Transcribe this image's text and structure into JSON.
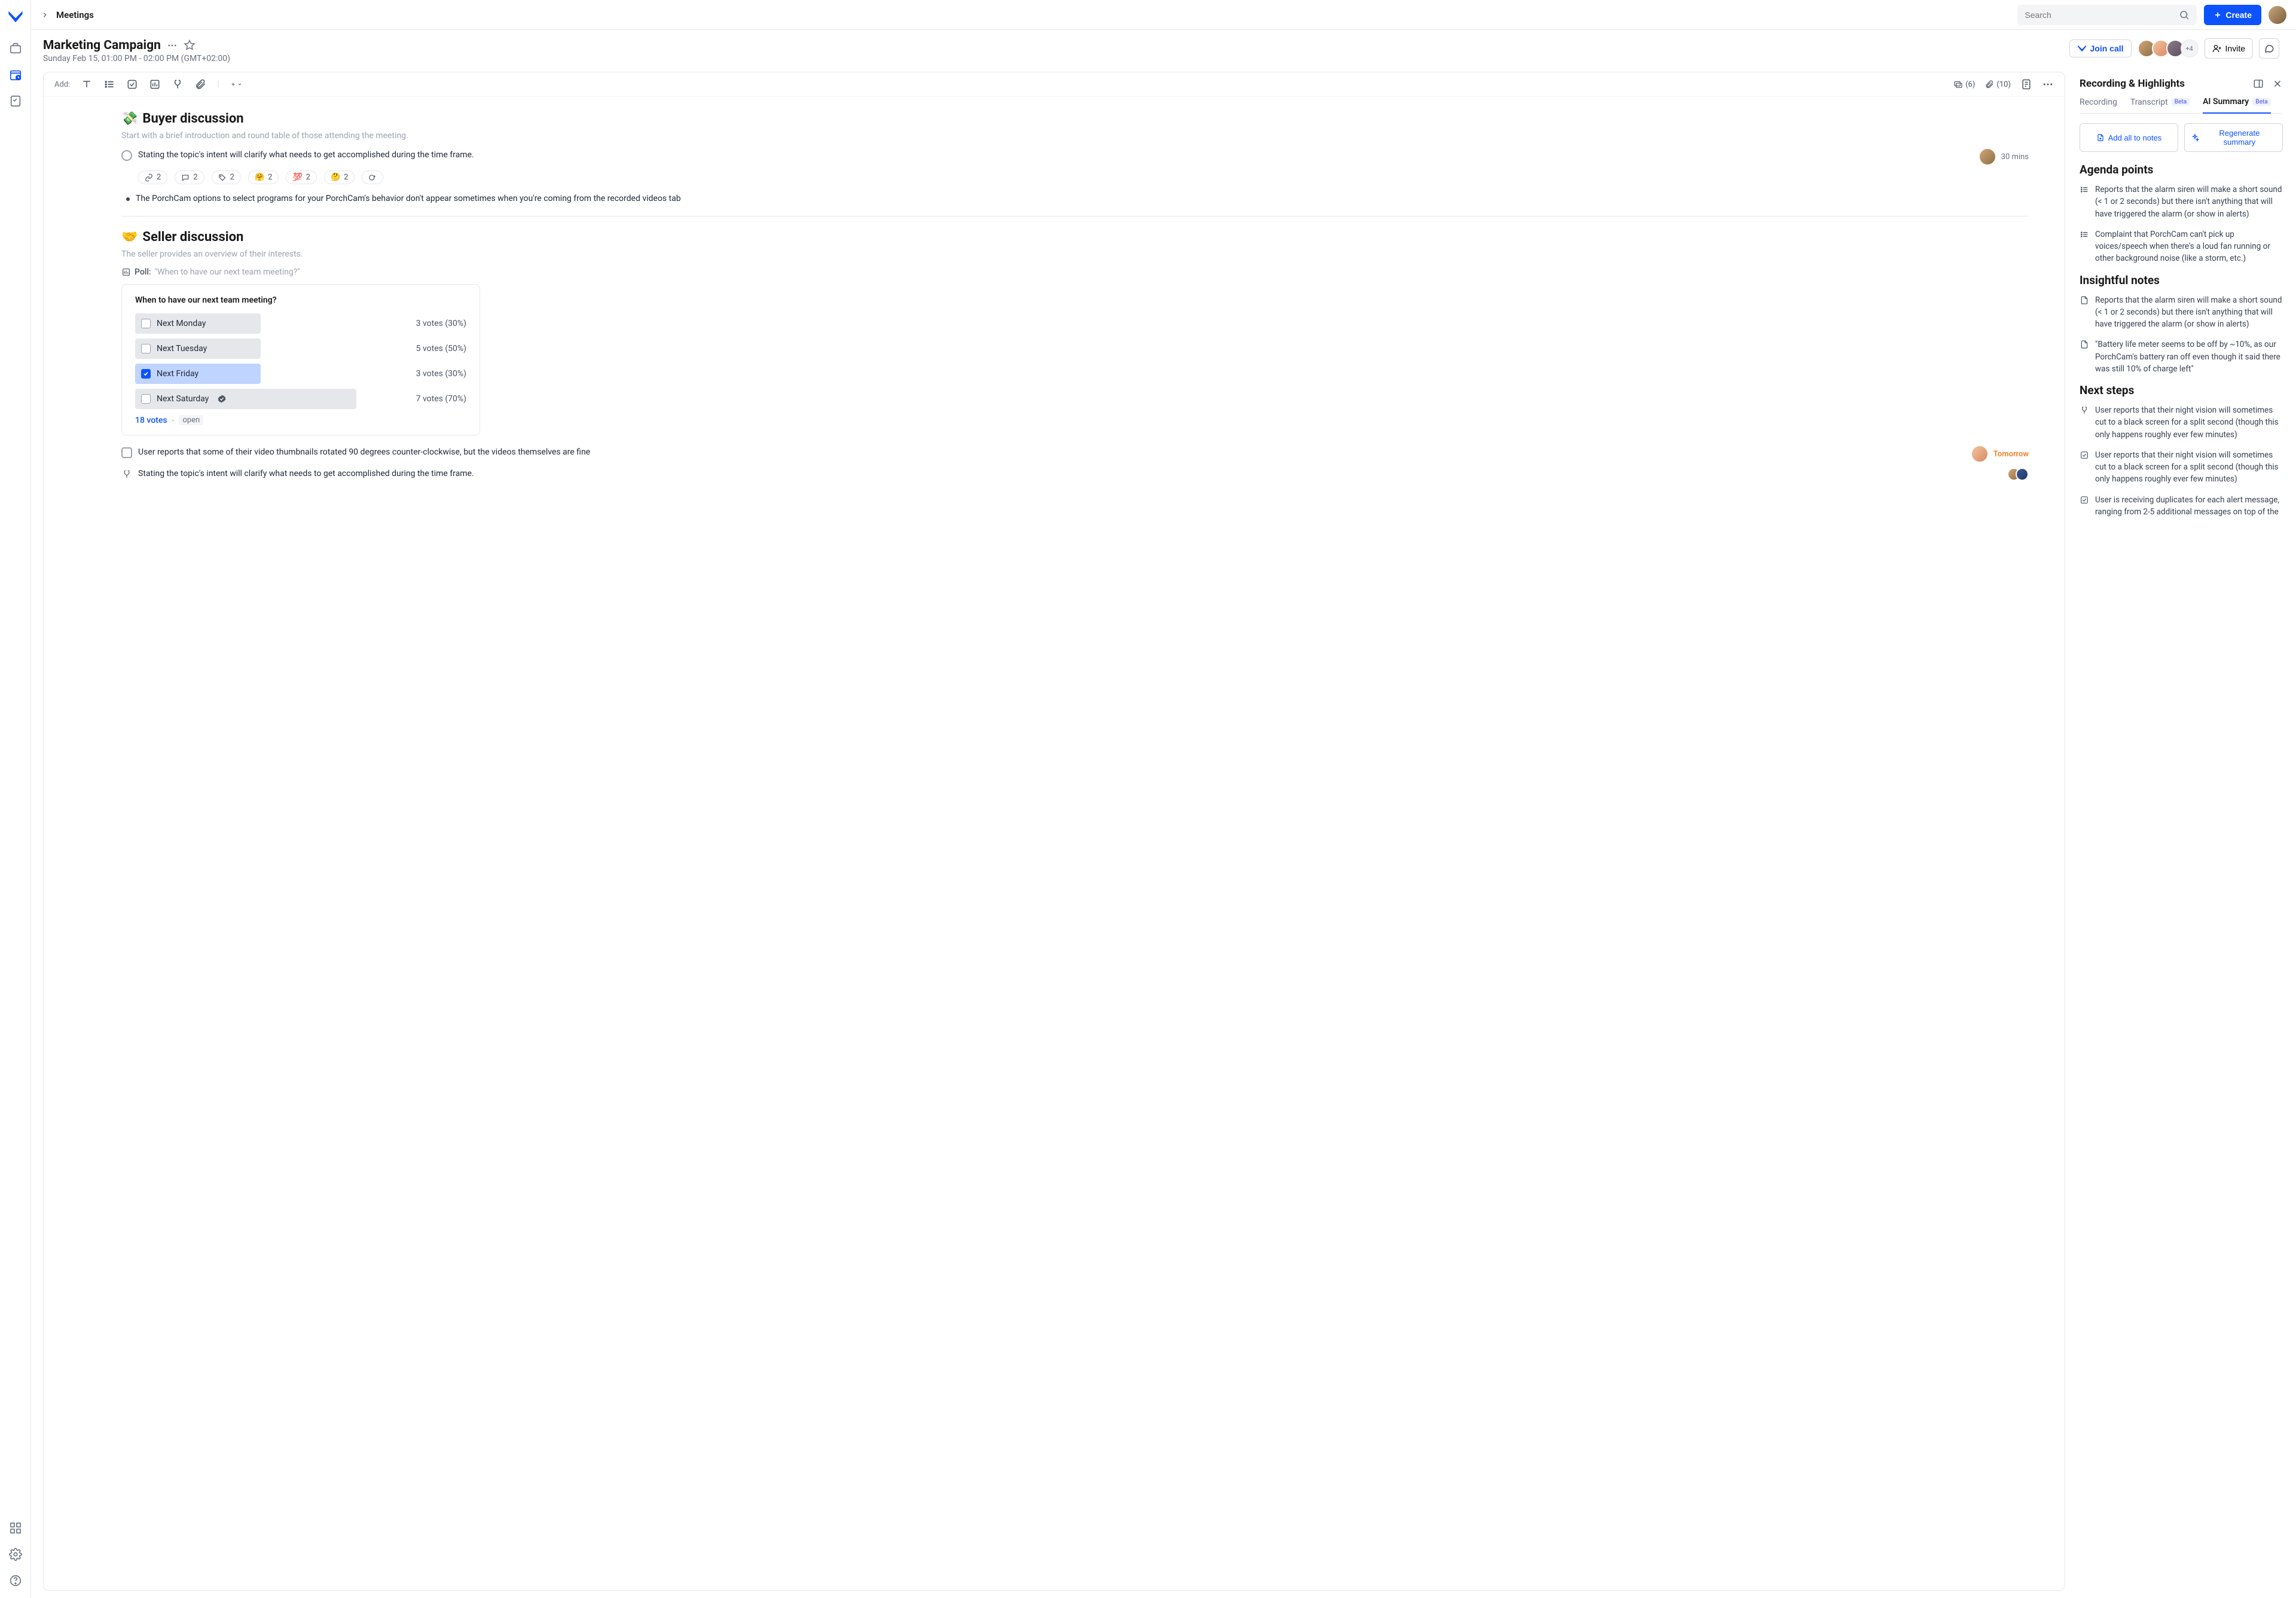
{
  "breadcrumb": {
    "page": "Meetings"
  },
  "search": {
    "placeholder": "Search"
  },
  "topbar": {
    "create": "Create"
  },
  "header": {
    "title": "Marketing Campaign",
    "subtitle": "Sunday Feb 15, 01:00 PM - 02:00 PM (GMT+02:00)",
    "join_call": "Join call",
    "more_count": "+4",
    "invite": "Invite"
  },
  "toolbar": {
    "add_label": "Add:",
    "comments_count": "(6)",
    "attachments_count": "(10)"
  },
  "section1": {
    "emoji": "💸",
    "title": "Buyer discussion",
    "desc": "Start with a brief introduction and round table of those attending the meeting.",
    "task1": "Stating the topic's intent will clarify what needs to get accomplished during the time frame.",
    "task1_due": "30 mins",
    "reactions": {
      "link": "2",
      "comment": "2",
      "tag": "2",
      "hug": "2",
      "hundred": "2",
      "thinking": "2",
      "hug_emoji": "🤗",
      "hundred_emoji": "💯",
      "thinking_emoji": "🤔"
    },
    "bullet1": "The PorchCam options to select programs for your PorchCam's behavior don't appear sometimes when you're coming from the recorded videos tab"
  },
  "section2": {
    "emoji": "🤝",
    "title": "Seller discussion",
    "desc": "The seller provides an overview of their interests.",
    "poll_label": "Poll:",
    "poll_question": "\"When to have our next team meeting?\"",
    "poll_title": "When to have our next team meeting?",
    "options": [
      {
        "label": "Next Monday",
        "votes": "3 votes (30%)",
        "checked": false
      },
      {
        "label": "Next Tuesday",
        "votes": "5 votes (50%)",
        "checked": false
      },
      {
        "label": "Next Friday",
        "votes": "3 votes (30%)",
        "checked": true
      },
      {
        "label": "Next Saturday",
        "votes": "7 votes (70%)",
        "checked": false,
        "verified": true
      }
    ],
    "poll_footer_votes": "18 votes",
    "poll_footer_dash": "-",
    "poll_footer_status": "open",
    "task2": "User reports that some of their video thumbnails rotated 90 degrees counter-clockwise, but the videos themselves are fine",
    "task2_due": "Tomorrow",
    "task3": "Stating the topic's intent will clarify what needs to get accomplished during the time frame."
  },
  "right_panel": {
    "title": "Recording & Highlights",
    "tabs": {
      "recording": "Recording",
      "transcript": "Transcript",
      "ai_summary": "AI Summary",
      "beta": "Beta"
    },
    "add_all": "Add all to notes",
    "regenerate": "Regenerate summary",
    "agenda_title": "Agenda points",
    "agenda": [
      "Reports that the alarm siren will make a short sound (< 1 or 2 seconds) but there isn't anything that will have triggered the alarm (or show in alerts)",
      "Complaint that PorchCam can't pick up voices/speech when there's a loud fan running or other background noise (like a storm, etc.)"
    ],
    "insightful_title": "Insightful notes",
    "insightful": [
      "Reports that the alarm siren will make a short sound (< 1 or 2 seconds) but there isn't anything that will have triggered the alarm (or show in alerts)",
      "\"Battery life meter seems to be off by ~10%, as our PorchCam's battery ran off even though it said there was still 10% of charge left\""
    ],
    "next_steps_title": "Next steps",
    "next_steps": [
      "User reports that their night vision will sometimes cut to a black screen for a split second (though this only happens roughly ever few minutes)",
      "User reports that their night vision will sometimes cut to a black screen for a split second (though this only happens roughly ever few minutes)",
      "User is receiving duplicates for each alert message, ranging from 2-5 additional messages on top of the"
    ]
  }
}
